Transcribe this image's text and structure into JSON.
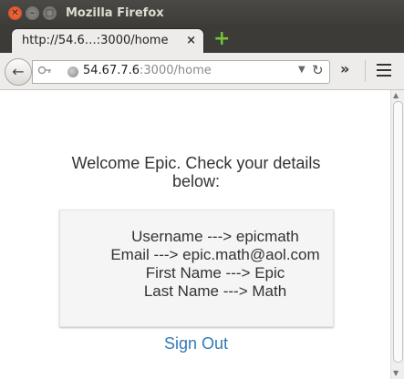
{
  "window": {
    "title": "Mozilla Firefox",
    "close_symbol": "✕",
    "min_symbol": "–",
    "max_symbol": "□"
  },
  "tab": {
    "label": "http://54.6…:3000/home",
    "close_symbol": "×",
    "new_tab_symbol": "+"
  },
  "navbar": {
    "back_symbol": "←",
    "url_host": "54.67.7.6",
    "url_rest": ":3000/home",
    "icons": [
      "back-arrow-icon",
      "key-icon",
      "globe-icon",
      "dropdown-icon",
      "reload-icon",
      "overflow-icon",
      "menu-icon"
    ],
    "overflow_symbol": "»"
  },
  "page": {
    "welcome_text": "Welcome Epic. Check your details below:",
    "details": {
      "username": "Username ---> epicmath",
      "email": "Email ---> epic.math@aol.com",
      "first_name": "First Name ---> Epic",
      "last_name": "Last Name ---> Math"
    },
    "signout_label": "Sign Out",
    "link_color": "#337ab7"
  }
}
